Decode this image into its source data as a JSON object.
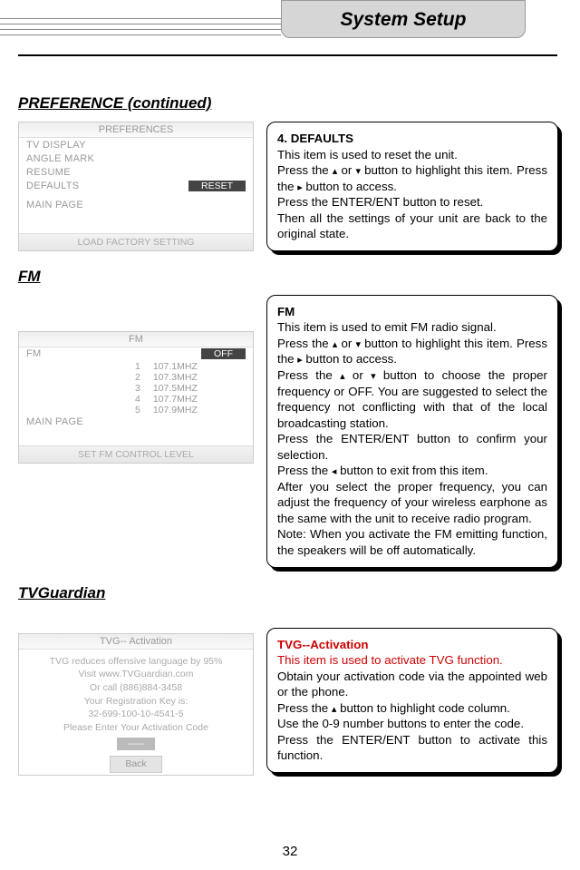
{
  "header": {
    "title": "System Setup"
  },
  "sections": {
    "pref_heading": "PREFERENCE (continued)",
    "fm_heading": "FM",
    "tvg_heading": "TVGuardian"
  },
  "mock_pref": {
    "title": "PREFERENCES",
    "items": [
      "TV DISPLAY",
      "ANGLE MARK",
      "RESUME",
      "DEFAULTS",
      "MAIN PAGE"
    ],
    "selected_value": "RESET",
    "footer": "LOAD FACTORY SETTING"
  },
  "mock_fm": {
    "title": "FM",
    "row_label": "FM",
    "row_value": "OFF",
    "main_page": "MAIN PAGE",
    "freqs": [
      {
        "n": "1",
        "v": "107.1MHZ"
      },
      {
        "n": "2",
        "v": "107.3MHZ"
      },
      {
        "n": "3",
        "v": "107.5MHZ"
      },
      {
        "n": "4",
        "v": "107.7MHZ"
      },
      {
        "n": "5",
        "v": "107.9MHZ"
      }
    ],
    "footer": "SET FM CONTROL LEVEL"
  },
  "mock_tvg": {
    "title": "TVG-- Activation",
    "line1": "TVG reduces offensive language by 95%",
    "line2": "Visit www.TVGuardian.com",
    "line3": "Or call (886)884-3458",
    "line4": "Your Registration Key is:",
    "line5": "32-699-100-10-4541-5",
    "line6": "Please Enter Your Activation Code",
    "dashes": "-----",
    "back": "Back"
  },
  "box_defaults": {
    "title": "4. DEFAULTS",
    "l1": "This item is used to reset the unit.",
    "l2a": "Press the ",
    "l2b": " or ",
    "l2c": " button to highlight this item. Press the ",
    "l2d": " button to access.",
    "l3": "Press the ENTER/ENT button to reset.",
    "l4": "Then all the settings of your unit are back to the original state."
  },
  "box_fm": {
    "title": "FM",
    "l1": "This item is used to emit FM radio signal.",
    "l2a": "Press the ",
    "l2b": " or ",
    "l2c": " button to highlight this item. Press the ",
    "l2d": " button to access.",
    "l3a": "Press the ",
    "l3b": " or ",
    "l3c": " button to choose the proper frequency or OFF. You are suggested to select the frequency not conflicting with that of the local broadcasting station.",
    "l4": "Press the ENTER/ENT button to confirm your selection.",
    "l5a": "Press the ",
    "l5b": " button to exit from this item.",
    "l6": "After you select the proper frequency, you can adjust the frequency of your wireless earphone as the same with the unit to receive radio program.",
    "l7": "Note: When you activate the FM emitting function, the speakers will be off automatically."
  },
  "box_tvg": {
    "title": "TVG--Activation",
    "l1": "This item is used to activate TVG function.",
    "l2": "Obtain your activation code via the appointed web or the phone.",
    "l3a": "Press the ",
    "l3b": " button to highlight code column.",
    "l4": "Use the 0-9 number buttons to enter the code.",
    "l5": "Press the ENTER/ENT button to activate this function."
  },
  "arrows": {
    "up": "▴",
    "down": "▾",
    "right": "▸",
    "left": "◂"
  },
  "page": "32"
}
